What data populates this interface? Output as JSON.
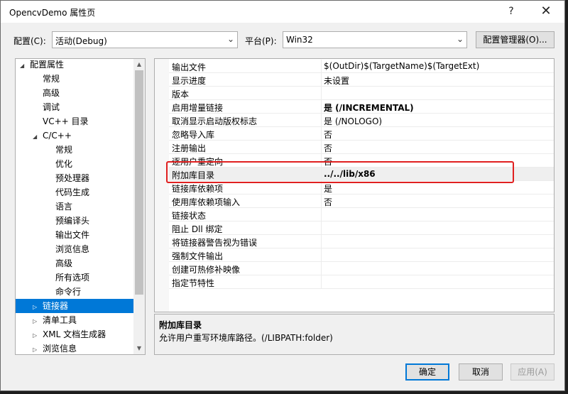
{
  "window": {
    "title": "OpencvDemo 属性页",
    "help_glyph": "?",
    "close_glyph": "✕"
  },
  "toolbar": {
    "config_label": "配置(C):",
    "config_value": "活动(Debug)",
    "platform_label": "平台(P):",
    "platform_value": "Win32",
    "config_manager_label": "配置管理器(O)...",
    "dropdown_icon": "chevron-down-icon"
  },
  "tree": {
    "expand_glyph": "▷",
    "collapse_glyph": "◢",
    "items": [
      {
        "label": "配置属性",
        "state": "expanded"
      },
      {
        "label": "常规",
        "state": "leaf"
      },
      {
        "label": "高级",
        "state": "leaf"
      },
      {
        "label": "调试",
        "state": "leaf"
      },
      {
        "label": "VC++ 目录",
        "state": "leaf"
      },
      {
        "label": "C/C++",
        "state": "expanded"
      },
      {
        "label": "常规",
        "state": "leaf"
      },
      {
        "label": "优化",
        "state": "leaf"
      },
      {
        "label": "预处理器",
        "state": "leaf"
      },
      {
        "label": "代码生成",
        "state": "leaf"
      },
      {
        "label": "语言",
        "state": "leaf"
      },
      {
        "label": "预编译头",
        "state": "leaf"
      },
      {
        "label": "输出文件",
        "state": "leaf"
      },
      {
        "label": "浏览信息",
        "state": "leaf"
      },
      {
        "label": "高级",
        "state": "leaf"
      },
      {
        "label": "所有选项",
        "state": "leaf"
      },
      {
        "label": "命令行",
        "state": "leaf"
      },
      {
        "label": "链接器",
        "state": "collapsed",
        "selected": true
      },
      {
        "label": "清单工具",
        "state": "collapsed"
      },
      {
        "label": "XML 文档生成器",
        "state": "collapsed"
      },
      {
        "label": "浏览信息",
        "state": "collapsed"
      }
    ],
    "scroll_up_glyph": "▲",
    "scroll_down_glyph": "▼"
  },
  "properties": {
    "rows": [
      {
        "name": "输出文件",
        "value": "$(OutDir)$(TargetName)$(TargetExt)",
        "bold": false
      },
      {
        "name": "显示进度",
        "value": "未设置",
        "bold": false
      },
      {
        "name": "版本",
        "value": "",
        "bold": false
      },
      {
        "name": "启用增量链接",
        "value": "是 (/INCREMENTAL)",
        "bold": true
      },
      {
        "name": "取消显示启动版权标志",
        "value": "是 (/NOLOGO)",
        "bold": false
      },
      {
        "name": "忽略导入库",
        "value": "否",
        "bold": false
      },
      {
        "name": "注册输出",
        "value": "否",
        "bold": false
      },
      {
        "name": "逐用户重定向",
        "value": "否",
        "bold": false
      },
      {
        "name": "附加库目录",
        "value": "../../lib/x86",
        "bold": true,
        "highlighted": true
      },
      {
        "name": "链接库依赖项",
        "value": "是",
        "bold": false
      },
      {
        "name": "使用库依赖项输入",
        "value": "否",
        "bold": false
      },
      {
        "name": "链接状态",
        "value": "",
        "bold": false
      },
      {
        "name": "阻止 Dll 绑定",
        "value": "",
        "bold": false
      },
      {
        "name": "将链接器警告视为错误",
        "value": "",
        "bold": false
      },
      {
        "name": "强制文件输出",
        "value": "",
        "bold": false
      },
      {
        "name": "创建可热修补映像",
        "value": "",
        "bold": false
      },
      {
        "name": "指定节特性",
        "value": "",
        "bold": false
      }
    ]
  },
  "description": {
    "title": "附加库目录",
    "text": "允许用户重写环境库路径。(/LIBPATH:folder)"
  },
  "buttons": {
    "ok": "确定",
    "cancel": "取消",
    "apply": "应用(A)"
  }
}
